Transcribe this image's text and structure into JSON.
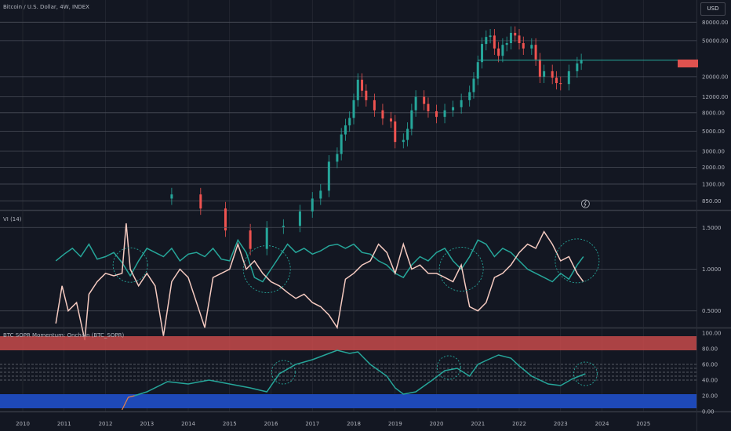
{
  "header": {
    "symbol_title": "Bitcoin / U.S. Dollar, 4W, INDEX",
    "currency_button": "USD"
  },
  "pane_titles": {
    "vi": "VI (14)",
    "sopr": "BTC SOPR Momentum: Onchain (BTC_SOPR)"
  },
  "colors": {
    "background": "#131722",
    "grid": "#2a2e39",
    "up_candle": "#26a69a",
    "down_candle": "#ef5350",
    "vi_plus": "#26a69a",
    "vi_minus": "#f6cbc1",
    "overbought_zone": "#c74a4a",
    "oversold_zone": "#1e49b8",
    "price_line": "#26a69a"
  },
  "chart_data": [
    {
      "type": "candlestick",
      "pane": "price",
      "scale": "log",
      "ylim": [
        700,
        120000
      ],
      "y_ticks": [
        "80000.00",
        "50000.00",
        "20000.00",
        "12000.00",
        "8000.00",
        "5000.00",
        "3000.00",
        "2000.00",
        "1300.00",
        "850.00"
      ],
      "x": [
        "2013.6",
        "2014.3",
        "2014.9",
        "2015.5",
        "2015.9",
        "2016.3",
        "2016.7",
        "2017.0",
        "2017.2",
        "2017.4",
        "2017.6",
        "2017.7",
        "2017.8",
        "2017.9",
        "2018.0",
        "2018.1",
        "2018.2",
        "2018.3",
        "2018.5",
        "2018.7",
        "2018.9",
        "2019.0",
        "2019.2",
        "2019.3",
        "2019.4",
        "2019.5",
        "2019.7",
        "2019.8",
        "2020.0",
        "2020.2",
        "2020.4",
        "2020.6",
        "2020.8",
        "2020.9",
        "2021.0",
        "2021.1",
        "2021.2",
        "2021.3",
        "2021.4",
        "2021.5",
        "2021.6",
        "2021.7",
        "2021.8",
        "2021.9",
        "2022.0",
        "2022.1",
        "2022.3",
        "2022.4",
        "2022.5",
        "2022.6",
        "2022.8",
        "2022.9",
        "2023.0",
        "2023.2",
        "2023.4",
        "2023.5"
      ],
      "close": [
        1000,
        700,
        400,
        250,
        430,
        450,
        650,
        900,
        1100,
        2300,
        2800,
        4600,
        5800,
        7000,
        11000,
        18500,
        14000,
        11000,
        8500,
        6900,
        6400,
        3800,
        4000,
        5300,
        8500,
        12000,
        10000,
        8300,
        7200,
        8500,
        9200,
        11000,
        13500,
        19000,
        29000,
        46000,
        55000,
        57000,
        41000,
        34000,
        45000,
        47000,
        61000,
        57000,
        47000,
        41000,
        45000,
        31000,
        20000,
        23000,
        19500,
        17000,
        16600,
        23000,
        28000,
        30400
      ],
      "price_line": 30400
    },
    {
      "type": "line",
      "pane": "vi",
      "ylim": [
        0.3,
        1.7
      ],
      "y_ticks": [
        "1.5000",
        "1.0000",
        "0.5000"
      ],
      "series": [
        {
          "key": "vi_plus",
          "x": [
            2010.8,
            2011.0,
            2011.2,
            2011.4,
            2011.6,
            2011.8,
            2012.0,
            2012.2,
            2012.4,
            2012.6,
            2012.8,
            2013.0,
            2013.2,
            2013.4,
            2013.6,
            2013.8,
            2014.0,
            2014.2,
            2014.4,
            2014.6,
            2014.8,
            2015.0,
            2015.2,
            2015.4,
            2015.6,
            2015.8,
            2016.0,
            2016.2,
            2016.4,
            2016.6,
            2016.8,
            2017.0,
            2017.2,
            2017.4,
            2017.6,
            2017.8,
            2018.0,
            2018.2,
            2018.4,
            2018.6,
            2018.8,
            2019.0,
            2019.2,
            2019.4,
            2019.6,
            2019.8,
            2020.0,
            2020.2,
            2020.4,
            2020.6,
            2020.8,
            2021.0,
            2021.2,
            2021.4,
            2021.6,
            2021.8,
            2022.0,
            2022.2,
            2022.4,
            2022.6,
            2022.8,
            2023.0,
            2023.2,
            2023.4,
            2023.55
          ],
          "values": [
            1.1,
            1.18,
            1.25,
            1.15,
            1.3,
            1.12,
            1.15,
            1.2,
            1.08,
            0.92,
            1.1,
            1.25,
            1.2,
            1.15,
            1.25,
            1.1,
            1.18,
            1.2,
            1.15,
            1.25,
            1.12,
            1.1,
            1.35,
            1.2,
            0.9,
            0.85,
            1.0,
            1.15,
            1.3,
            1.2,
            1.25,
            1.18,
            1.22,
            1.28,
            1.3,
            1.25,
            1.3,
            1.2,
            1.18,
            1.1,
            1.05,
            0.95,
            0.9,
            1.05,
            1.15,
            1.1,
            1.2,
            1.25,
            1.1,
            1.0,
            1.15,
            1.35,
            1.3,
            1.15,
            1.25,
            1.2,
            1.1,
            1.0,
            0.95,
            0.9,
            0.85,
            0.95,
            0.88,
            1.05,
            1.15
          ]
        },
        {
          "key": "vi_minus",
          "x": [
            2010.8,
            2010.95,
            2011.1,
            2011.3,
            2011.5,
            2011.6,
            2011.8,
            2012.0,
            2012.2,
            2012.4,
            2012.5,
            2012.6,
            2012.8,
            2013.0,
            2013.2,
            2013.4,
            2013.6,
            2013.8,
            2014.0,
            2014.2,
            2014.4,
            2014.6,
            2014.8,
            2015.0,
            2015.2,
            2015.4,
            2015.6,
            2015.8,
            2016.0,
            2016.2,
            2016.4,
            2016.6,
            2016.8,
            2017.0,
            2017.2,
            2017.4,
            2017.6,
            2017.8,
            2018.0,
            2018.2,
            2018.4,
            2018.6,
            2018.8,
            2019.0,
            2019.2,
            2019.4,
            2019.6,
            2019.8,
            2020.0,
            2020.2,
            2020.4,
            2020.6,
            2020.8,
            2021.0,
            2021.2,
            2021.4,
            2021.6,
            2021.8,
            2022.0,
            2022.2,
            2022.4,
            2022.6,
            2022.8,
            2023.0,
            2023.2,
            2023.4,
            2023.55
          ],
          "values": [
            0.35,
            0.8,
            0.5,
            0.6,
            0.15,
            0.7,
            0.85,
            0.95,
            0.92,
            0.95,
            1.55,
            1.0,
            0.8,
            0.95,
            0.8,
            0.2,
            0.85,
            1.0,
            0.9,
            0.6,
            0.3,
            0.9,
            0.95,
            1.0,
            1.3,
            1.0,
            1.1,
            0.95,
            0.85,
            0.8,
            0.72,
            0.65,
            0.7,
            0.6,
            0.55,
            0.45,
            0.3,
            0.88,
            0.95,
            1.05,
            1.1,
            1.3,
            1.2,
            0.95,
            1.3,
            1.0,
            1.05,
            0.95,
            0.95,
            0.9,
            0.85,
            1.05,
            0.55,
            0.5,
            0.6,
            0.9,
            0.95,
            1.05,
            1.2,
            1.3,
            1.25,
            1.45,
            1.3,
            1.1,
            1.15,
            0.95,
            0.85
          ]
        }
      ]
    },
    {
      "type": "line",
      "pane": "sopr",
      "ylim": [
        0,
        100
      ],
      "y_ticks": [
        "100.00",
        "80.00",
        "60.00",
        "40.00",
        "20.00",
        "0.00"
      ],
      "bands": {
        "overbought": [
          78,
          96
        ],
        "oversold": [
          4,
          22
        ],
        "dashed_levels": [
          60,
          55,
          50,
          45,
          40
        ]
      },
      "x": [
        2012.7,
        2013.0,
        2013.5,
        2014.0,
        2014.5,
        2015.0,
        2015.5,
        2015.9,
        2016.2,
        2016.6,
        2017.0,
        2017.3,
        2017.6,
        2017.9,
        2018.1,
        2018.4,
        2018.8,
        2019.0,
        2019.2,
        2019.5,
        2019.9,
        2020.2,
        2020.5,
        2020.8,
        2021.0,
        2021.2,
        2021.5,
        2021.8,
        2022.0,
        2022.3,
        2022.7,
        2023.0,
        2023.3,
        2023.6
      ],
      "values": [
        20,
        25,
        38,
        35,
        40,
        35,
        30,
        25,
        48,
        60,
        66,
        72,
        78,
        74,
        76,
        60,
        45,
        30,
        22,
        25,
        40,
        52,
        55,
        45,
        60,
        65,
        72,
        68,
        58,
        45,
        35,
        33,
        42,
        48
      ],
      "annotation": "lightning-icon"
    }
  ],
  "x_axis": {
    "labels": [
      "2010",
      "2011",
      "2012",
      "2013",
      "2014",
      "2015",
      "2016",
      "2017",
      "2018",
      "2019",
      "2020",
      "2021",
      "2022",
      "2023",
      "2024",
      "2025"
    ]
  }
}
